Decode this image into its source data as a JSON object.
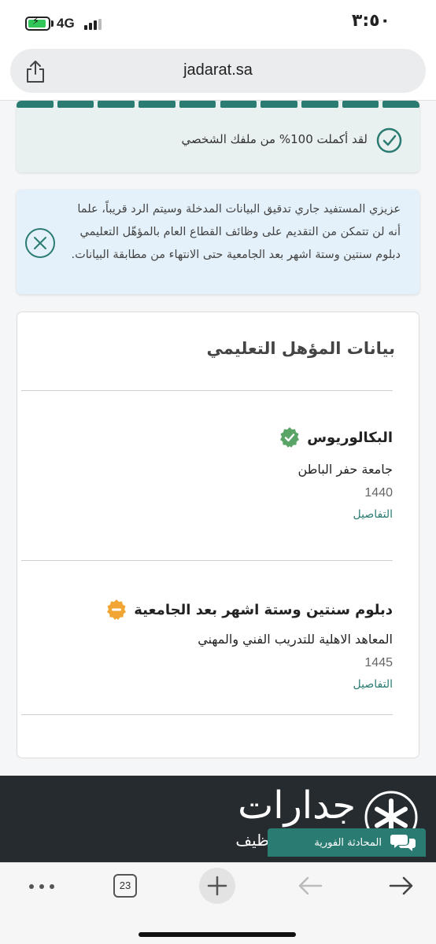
{
  "status_bar": {
    "time": "٣:٥٠",
    "network": "4G",
    "battery_level": 0.9
  },
  "browser": {
    "url": "jadarat.sa",
    "open_tabs_count": "23"
  },
  "profile_progress": {
    "message": "لقد أكملت 100% من ملفك الشخصي",
    "percent": 100,
    "segments": 10,
    "color": "#2a7b72"
  },
  "notice": {
    "text": "عزيزي المستفيد جاري تدقيق البيانات المدخلة وسيتم الرد قريباً، علما أنه لن تتمكن من التقديم على وظائف القطاع العام بالمؤهّل التعليمي دبلوم سنتين وستة اشهر بعد الجامعية حتى الانتهاء من مطابقة البيانات."
  },
  "education": {
    "title": "بيانات المؤهل التعليمي",
    "items": [
      {
        "degree": "البكالوريوس",
        "status": "verified",
        "institution": "جامعة حفر الباطن",
        "year": "1440",
        "details_label": "التفاصيل"
      },
      {
        "degree": "دبلوم سنتين وستة اشهر بعد الجامعية",
        "status": "pending",
        "institution": "المعاهد الاهلية للتدريب الفني والمهني",
        "year": "1445",
        "details_label": "التفاصيل"
      }
    ]
  },
  "footer": {
    "brand": "جدارات",
    "subtitle": "الوطنيـة للتوظيف",
    "chat_label": "المحادثة الفورية"
  },
  "colors": {
    "brand_teal": "#2a7b72",
    "verified_green": "#5aa468",
    "pending_orange": "#f0a534",
    "footer_dark": "#262b30"
  },
  "icons": {
    "progress": "check-circle-icon",
    "notice": "close-circle-icon",
    "verified": "verified-badge-icon",
    "pending": "pending-badge-icon",
    "chat": "chat-bubbles-icon"
  }
}
